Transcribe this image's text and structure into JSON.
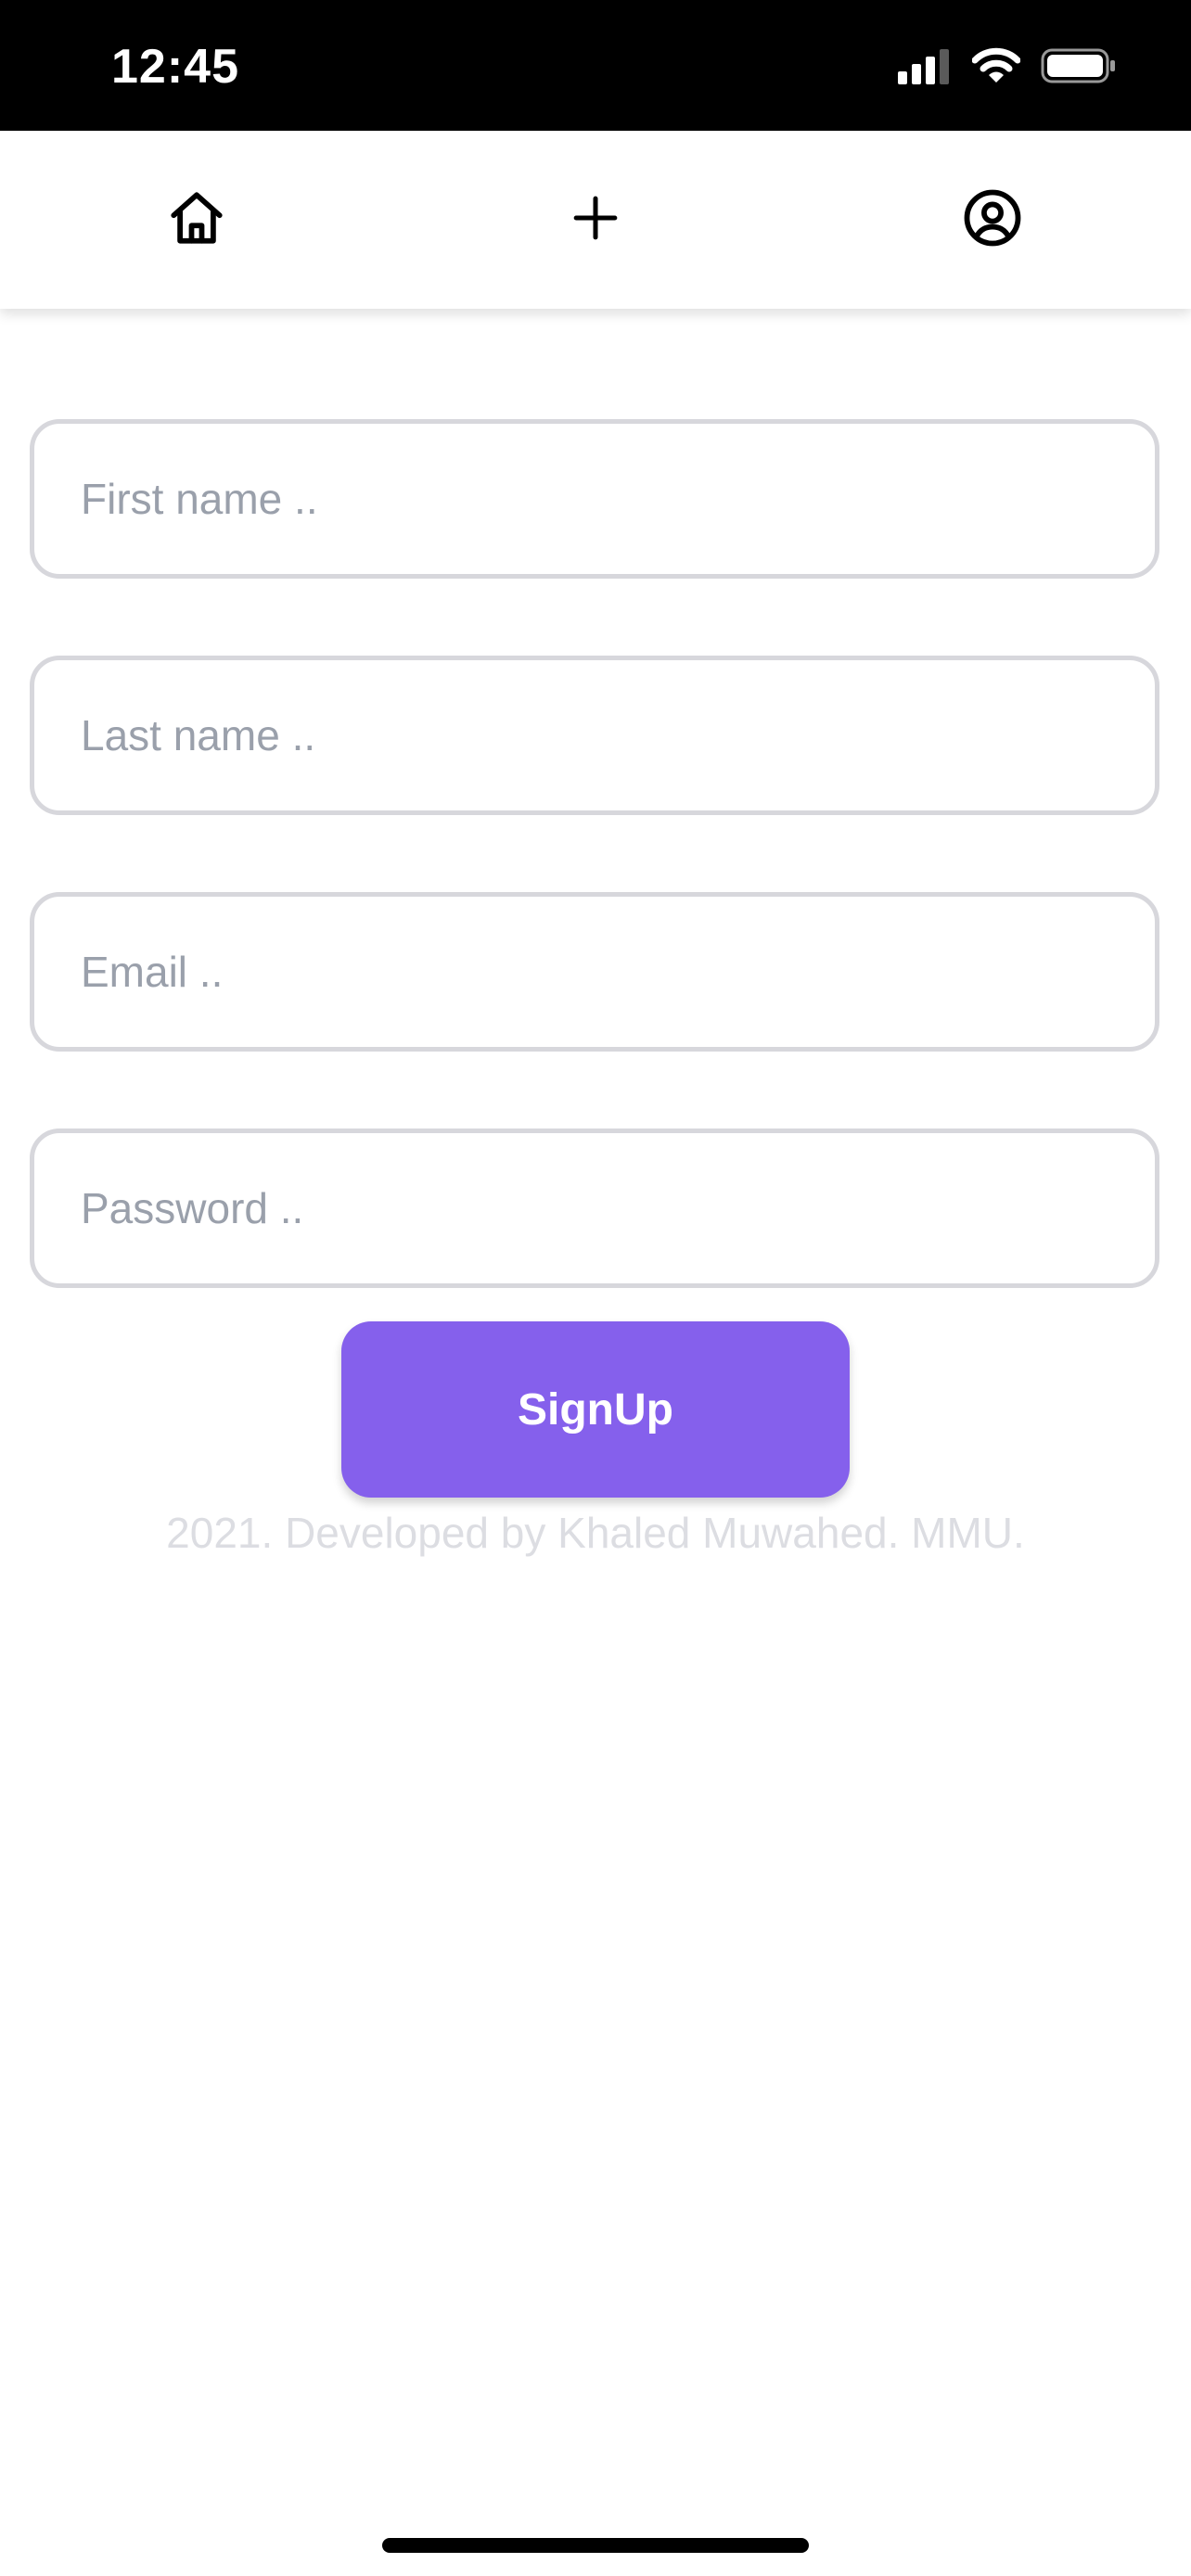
{
  "status_bar": {
    "time": "12:45",
    "icons": [
      "cellular-signal-icon",
      "wifi-icon",
      "battery-icon"
    ]
  },
  "nav": {
    "items": [
      {
        "icon": "home-icon"
      },
      {
        "icon": "plus-icon"
      },
      {
        "icon": "user-circle-icon"
      }
    ]
  },
  "form": {
    "first_name": {
      "placeholder": "First name ..",
      "value": ""
    },
    "last_name": {
      "placeholder": "Last name ..",
      "value": ""
    },
    "email": {
      "placeholder": "Email ..",
      "value": ""
    },
    "password": {
      "placeholder": "Password ..",
      "value": ""
    },
    "submit_label": "SignUp"
  },
  "footer": {
    "text": "2021. Developed by Khaled Muwahed. MMU."
  },
  "colors": {
    "accent": "#8560ec",
    "field_border": "#d7d7dc",
    "placeholder": "#9aa0ab",
    "footer_text": "#dcdde2",
    "status_bar_bg": "#000000"
  }
}
